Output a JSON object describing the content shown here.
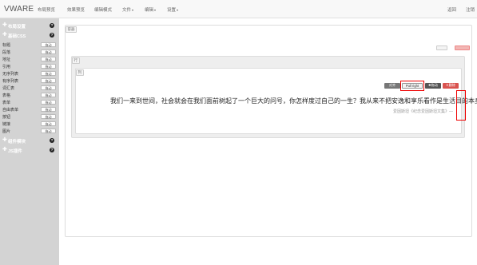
{
  "navbar": {
    "brand": "VWARE",
    "items": [
      "布局预览",
      "效果预览",
      "编辑模式",
      "文件",
      "编辑",
      "设置"
    ],
    "right_items": [
      "返回",
      "注销"
    ]
  },
  "sidebar": {
    "sections": [
      {
        "title": "布局设置"
      },
      {
        "title": "基础CSS"
      },
      {
        "title": "组件模块"
      },
      {
        "title": "JS插件"
      }
    ],
    "help_glyph": "?",
    "drag_label": "拖动",
    "items": [
      "标题",
      "段落",
      "地址",
      "引用",
      "无序列表",
      "有序列表",
      "词汇表",
      "表格",
      "表单",
      "自由表单",
      "按钮",
      "链接",
      "图片"
    ]
  },
  "canvas": {
    "container_tag": "容器",
    "row_tag": "行",
    "column_tag": "列",
    "controls": {
      "alignment_label": "对齐",
      "pull_right_label": "Pull right",
      "remove_label": "删除"
    },
    "quote": {
      "text": "我们一来到世间，社会就会在我们面前树起了一个巨大的问号，你怎样度过自己的一生？我从来不把安逸和享乐看作是生活目的本身。",
      "source": "爱因斯坦《纪念爱因斯坦文集》—"
    }
  },
  "colors": {
    "sidebar_bg": "#d3d3d3",
    "highlight_border": "#e00000",
    "danger": "#d9534f"
  }
}
